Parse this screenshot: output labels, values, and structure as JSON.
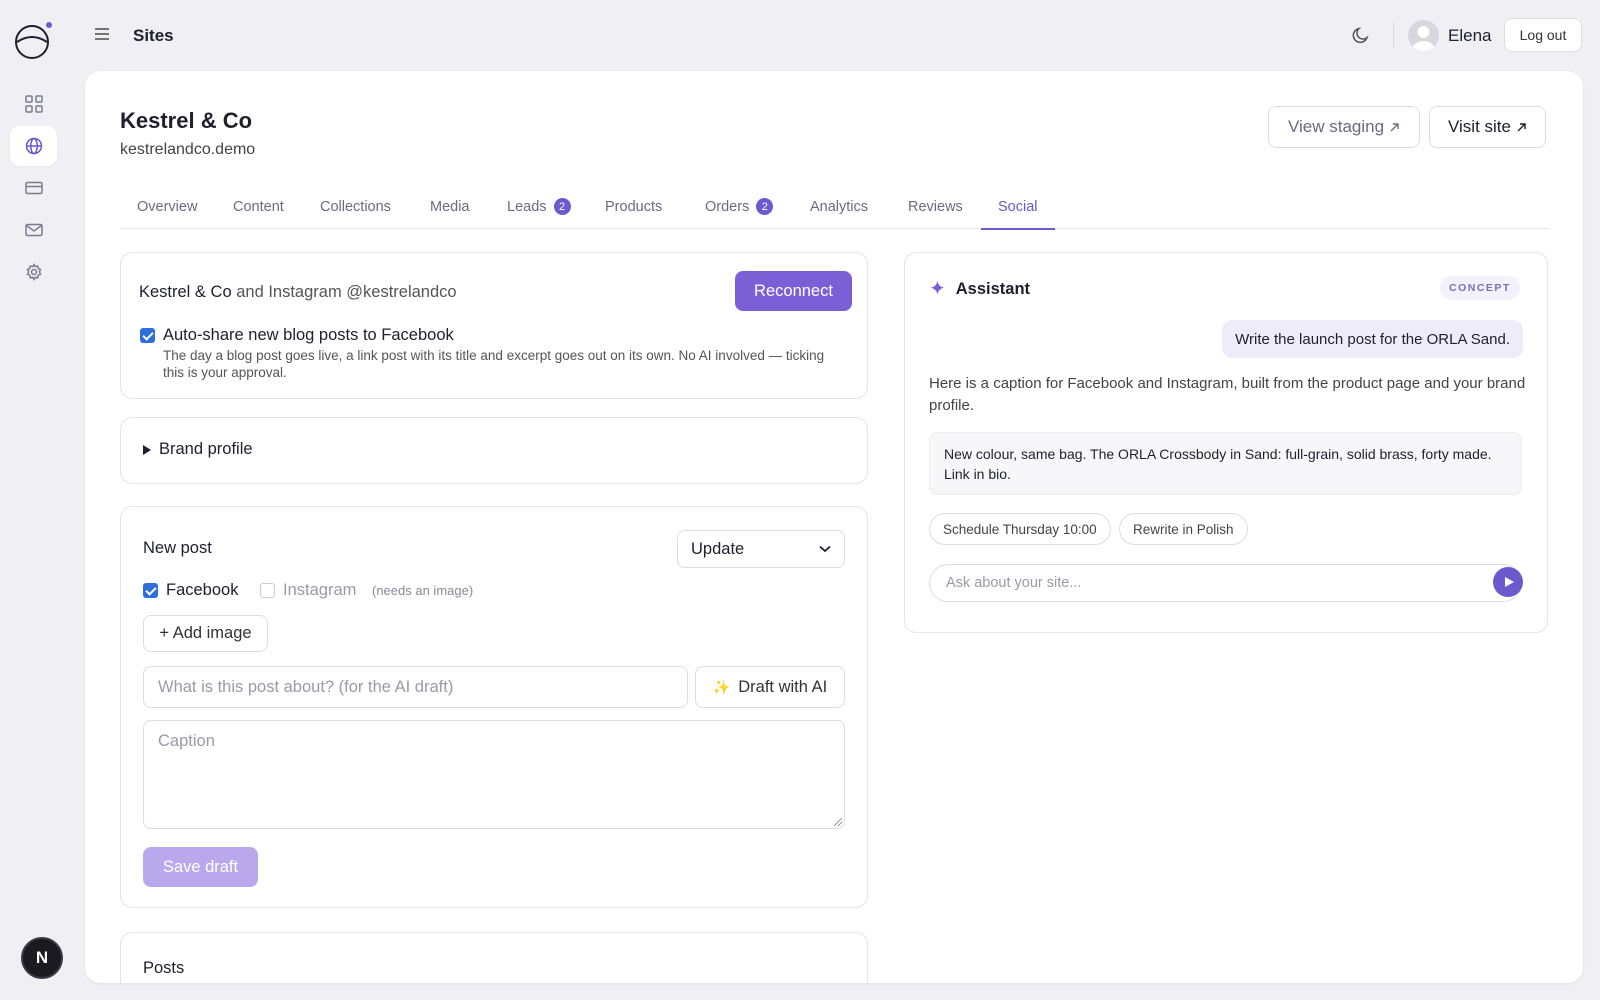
{
  "topbar": {
    "title": "Sites",
    "user_name": "Elena",
    "logout_label": "Log out"
  },
  "rail": {
    "items": [
      {
        "icon": "grid-icon"
      },
      {
        "icon": "globe-icon",
        "active": true
      },
      {
        "icon": "card-icon"
      },
      {
        "icon": "mail-icon"
      },
      {
        "icon": "gear-icon"
      }
    ],
    "bottom_avatar": "N"
  },
  "site": {
    "name": "Kestrel & Co",
    "domain": "kestrelandco.demo",
    "view_staging": "View staging",
    "visit_site": "Visit site"
  },
  "tabs": [
    {
      "label": "Overview"
    },
    {
      "label": "Content"
    },
    {
      "label": "Collections"
    },
    {
      "label": "Media"
    },
    {
      "label": "Leads",
      "badge": "2"
    },
    {
      "label": "Products"
    },
    {
      "label": "Orders",
      "badge": "2"
    },
    {
      "label": "Analytics"
    },
    {
      "label": "Reviews"
    },
    {
      "label": "Social",
      "active": true
    }
  ],
  "connection": {
    "brand": "Kestrel & Co",
    "rest": "and Instagram @kestrelandco",
    "reconnect_label": "Reconnect",
    "autoshare_label": "Auto-share new blog posts to Facebook",
    "autoshare_checked": true,
    "autoshare_desc": "The day a blog post goes live, a link post with its title and excerpt goes out on its own. No AI involved — ticking this is your approval."
  },
  "brand_profile": {
    "label": "Brand profile"
  },
  "new_post": {
    "title": "New post",
    "type_selected": "Update",
    "facebook_label": "Facebook",
    "facebook_checked": true,
    "instagram_label": "Instagram",
    "instagram_checked": false,
    "instagram_note": "(needs an image)",
    "add_image_label": "+ Add image",
    "about_placeholder": "What is this post about? (for the AI draft)",
    "draft_label": "Draft with AI",
    "caption_placeholder": "Caption",
    "save_label": "Save draft"
  },
  "posts": {
    "title": "Posts"
  },
  "assistant": {
    "title": "Assistant",
    "badge": "CONCEPT",
    "user_message": "Write the launch post for the ORLA Sand.",
    "reply": "Here is a caption for Facebook and Instagram, built from the product page and your brand profile.",
    "caption_quote": "New colour, same bag. The ORLA Crossbody in Sand: full-grain, solid brass, forty made. Link in bio.",
    "chips": [
      "Schedule Thursday 10:00",
      "Rewrite in Polish"
    ],
    "ask_placeholder": "Ask about your site..."
  },
  "colors": {
    "accent": "#6a5acd",
    "primary_button": "#7b5fd6",
    "disabled_button": "#b9a9ec",
    "background": "#efeff4"
  }
}
